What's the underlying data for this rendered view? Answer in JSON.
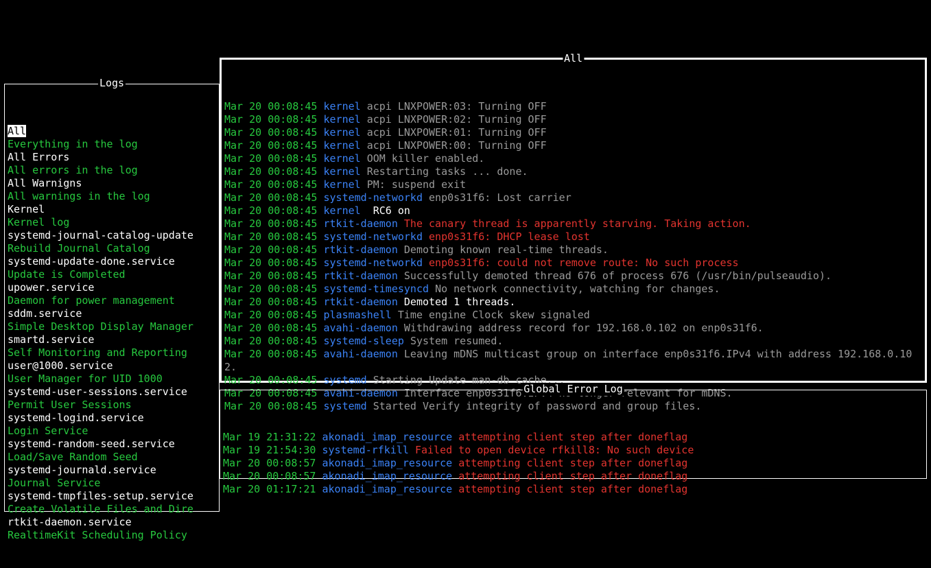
{
  "panels": {
    "logs_title": "Logs",
    "all_title": "All",
    "error_title": "Global Error Log"
  },
  "colors": {
    "green": "#27c93f",
    "blue": "#3b82f6",
    "red": "#e3342f",
    "gray": "#9a9a9a",
    "white": "#ffffff"
  },
  "log_filters": [
    {
      "label": "All",
      "color": "white",
      "selected": true
    },
    {
      "label": "Everything in the log",
      "color": "green"
    },
    {
      "label": "All Errors",
      "color": "white"
    },
    {
      "label": "All errors in the log",
      "color": "green"
    },
    {
      "label": "All Warnigns",
      "color": "white"
    },
    {
      "label": "All warnings in the log",
      "color": "green"
    },
    {
      "label": "Kernel",
      "color": "white"
    },
    {
      "label": "Kernel log",
      "color": "green"
    },
    {
      "label": "systemd-journal-catalog-update",
      "color": "white"
    },
    {
      "label": "Rebuild Journal Catalog",
      "color": "green"
    },
    {
      "label": "systemd-update-done.service",
      "color": "white"
    },
    {
      "label": "Update is Completed",
      "color": "green"
    },
    {
      "label": "upower.service",
      "color": "white"
    },
    {
      "label": "Daemon for power management",
      "color": "green"
    },
    {
      "label": "sddm.service",
      "color": "white"
    },
    {
      "label": "Simple Desktop Display Manager",
      "color": "green"
    },
    {
      "label": "smartd.service",
      "color": "white"
    },
    {
      "label": "Self Monitoring and Reporting",
      "color": "green"
    },
    {
      "label": "user@1000.service",
      "color": "white"
    },
    {
      "label": "User Manager for UID 1000",
      "color": "green"
    },
    {
      "label": "systemd-user-sessions.service",
      "color": "white"
    },
    {
      "label": "Permit User Sessions",
      "color": "green"
    },
    {
      "label": "systemd-logind.service",
      "color": "white"
    },
    {
      "label": "Login Service",
      "color": "green"
    },
    {
      "label": "systemd-random-seed.service",
      "color": "white"
    },
    {
      "label": "Load/Save Random Seed",
      "color": "green"
    },
    {
      "label": "systemd-journald.service",
      "color": "white"
    },
    {
      "label": "Journal Service",
      "color": "green"
    },
    {
      "label": "systemd-tmpfiles-setup.service",
      "color": "white"
    },
    {
      "label": "Create Volatile Files and Dire",
      "color": "green"
    },
    {
      "label": "rtkit-daemon.service",
      "color": "white"
    },
    {
      "label": "RealtimeKit Scheduling Policy",
      "color": "green"
    }
  ],
  "main_log": [
    {
      "ts": "Mar 20 00:08:45",
      "src": "kernel",
      "msg": "acpi LNXPOWER:03: Turning OFF",
      "msg_color": "gray"
    },
    {
      "ts": "Mar 20 00:08:45",
      "src": "kernel",
      "msg": "acpi LNXPOWER:02: Turning OFF",
      "msg_color": "gray"
    },
    {
      "ts": "Mar 20 00:08:45",
      "src": "kernel",
      "msg": "acpi LNXPOWER:01: Turning OFF",
      "msg_color": "gray"
    },
    {
      "ts": "Mar 20 00:08:45",
      "src": "kernel",
      "msg": "acpi LNXPOWER:00: Turning OFF",
      "msg_color": "gray"
    },
    {
      "ts": "Mar 20 00:08:45",
      "src": "kernel",
      "msg": "OOM killer enabled.",
      "msg_color": "gray"
    },
    {
      "ts": "Mar 20 00:08:45",
      "src": "kernel",
      "msg": "Restarting tasks ... done.",
      "msg_color": "gray"
    },
    {
      "ts": "Mar 20 00:08:45",
      "src": "kernel",
      "msg": "PM: suspend exit",
      "msg_color": "gray"
    },
    {
      "ts": "Mar 20 00:08:45",
      "src": "systemd-networkd",
      "msg": "enp0s31f6: Lost carrier",
      "msg_color": "gray"
    },
    {
      "ts": "Mar 20 00:08:45",
      "src": "kernel",
      "msg": " RC6 on",
      "msg_color": "white"
    },
    {
      "ts": "Mar 20 00:08:45",
      "src": "rtkit-daemon",
      "msg": "The canary thread is apparently starving. Taking action.",
      "msg_color": "red"
    },
    {
      "ts": "Mar 20 00:08:45",
      "src": "systemd-networkd",
      "msg": "enp0s31f6: DHCP lease lost",
      "msg_color": "red"
    },
    {
      "ts": "Mar 20 00:08:45",
      "src": "rtkit-daemon",
      "msg": "Demoting known real-time threads.",
      "msg_color": "gray"
    },
    {
      "ts": "Mar 20 00:08:45",
      "src": "systemd-networkd",
      "msg": "enp0s31f6: could not remove route: No such process",
      "msg_color": "red"
    },
    {
      "ts": "Mar 20 00:08:45",
      "src": "rtkit-daemon",
      "msg": "Successfully demoted thread 676 of process 676 (/usr/bin/pulseaudio).",
      "msg_color": "gray"
    },
    {
      "ts": "Mar 20 00:08:45",
      "src": "systemd-timesyncd",
      "msg": "No network connectivity, watching for changes.",
      "msg_color": "gray"
    },
    {
      "ts": "Mar 20 00:08:45",
      "src": "rtkit-daemon",
      "msg": "Demoted 1 threads.",
      "msg_color": "white"
    },
    {
      "ts": "Mar 20 00:08:45",
      "src": "plasmashell",
      "msg": "Time engine Clock skew signaled",
      "msg_color": "gray"
    },
    {
      "ts": "Mar 20 00:08:45",
      "src": "avahi-daemon",
      "msg": "Withdrawing address record for 192.168.0.102 on enp0s31f6.",
      "msg_color": "gray"
    },
    {
      "ts": "Mar 20 00:08:45",
      "src": "systemd-sleep",
      "msg": "System resumed.",
      "msg_color": "gray"
    },
    {
      "ts": "Mar 20 00:08:45",
      "src": "avahi-daemon",
      "msg": "Leaving mDNS multicast group on interface enp0s31f6.IPv4 with address 192.168.0.102.",
      "msg_color": "gray"
    },
    {
      "ts": "Mar 20 00:08:45",
      "src": "systemd",
      "msg": "Starting Update man-db cache...",
      "msg_color": "gray"
    },
    {
      "ts": "Mar 20 00:08:45",
      "src": "avahi-daemon",
      "msg": "Interface enp0s31f6.IPv4 no longer relevant for mDNS.",
      "msg_color": "gray"
    },
    {
      "ts": "Mar 20 00:08:45",
      "src": "systemd",
      "msg": "Started Verify integrity of password and group files.",
      "msg_color": "gray"
    }
  ],
  "error_log": [
    {
      "ts": "Mar 19 21:31:22",
      "src": "akonadi_imap_resource",
      "msg": "attempting client step after doneflag",
      "msg_color": "red"
    },
    {
      "ts": "Mar 19 21:54:30",
      "src": "systemd-rfkill",
      "msg": "Failed to open device rfkill8: No such device",
      "msg_color": "red"
    },
    {
      "ts": "Mar 20 00:08:57",
      "src": "akonadi_imap_resource",
      "msg": "attempting client step after doneflag",
      "msg_color": "red"
    },
    {
      "ts": "Mar 20 00:08:57",
      "src": "akonadi_imap_resource",
      "msg": "attempting client step after doneflag",
      "msg_color": "red"
    },
    {
      "ts": "Mar 20 01:17:21",
      "src": "akonadi_imap_resource",
      "msg": "attempting client step after doneflag",
      "msg_color": "red"
    }
  ]
}
